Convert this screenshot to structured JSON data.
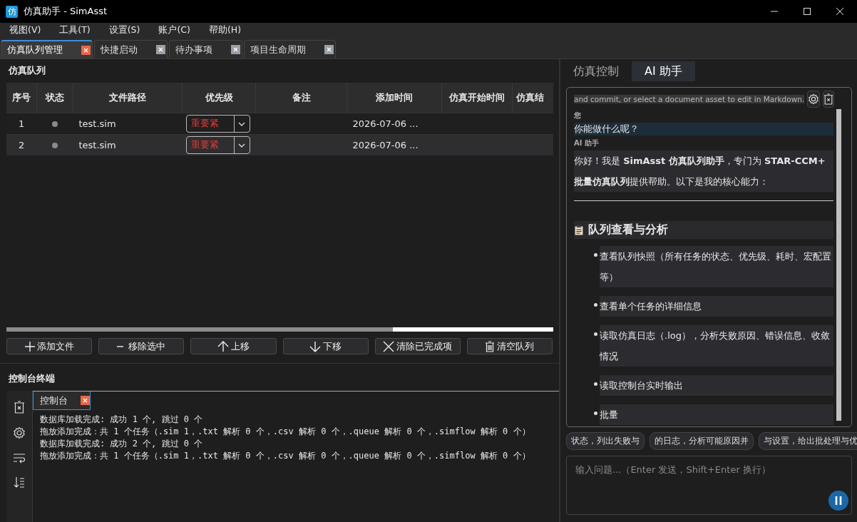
{
  "window": {
    "title": "仿真助手 - SimAsst",
    "app_icon_text": "仿"
  },
  "menu": [
    "视图(V)",
    "工具(T)",
    "设置(S)",
    "账户(C)",
    "帮助(H)"
  ],
  "tabs": [
    {
      "label": "仿真队列管理",
      "selected": true
    },
    {
      "label": "快捷启动",
      "selected": false
    },
    {
      "label": "待办事项",
      "selected": false
    },
    {
      "label": "项目生命周期",
      "selected": false
    }
  ],
  "queue": {
    "title": "仿真队列",
    "columns": [
      "序号",
      "状态",
      "文件路径",
      "优先级",
      "备注",
      "添加时间",
      "仿真开始时间",
      "仿真结"
    ],
    "rows": [
      {
        "index": "1",
        "path": "test.sim",
        "priority": "重要紧",
        "added": "2026-07-06 ...",
        "selected": false
      },
      {
        "index": "2",
        "path": "test.sim",
        "priority": "重要紧",
        "added": "2026-07-06 ...",
        "selected": true
      }
    ],
    "buttons": [
      {
        "kind": "add",
        "label": "添加文件"
      },
      {
        "kind": "remove",
        "label": "移除选中"
      },
      {
        "kind": "up",
        "label": "上移"
      },
      {
        "kind": "down",
        "label": "下移"
      },
      {
        "kind": "clear",
        "label": "清除已完成项"
      },
      {
        "kind": "trash",
        "label": "清空队列"
      }
    ]
  },
  "console": {
    "title": "控制台终端",
    "tab": "控制台",
    "lines": [
      "数据库加载完成: 成功 1 个, 跳过 0 个",
      "拖放添加完成：共 1 个任务（.sim 1，.txt 解析 0 个，.csv 解析 0 个，.queue 解析 0 个，.simflow 解析 0 个）",
      "数据库加载完成: 成功 2 个, 跳过 0 个",
      "拖放添加完成：共 1 个任务（.sim 1，.txt 解析 0 个，.csv 解析 0 个，.queue 解析 0 个，.simflow 解析 0 个）"
    ]
  },
  "side_tabs": [
    {
      "label": "仿真控制",
      "selected": false
    },
    {
      "label": "AI 助手",
      "selected": true
    }
  ],
  "chat": {
    "top_text": "and commit, or select a document asset to edit in Markdown.",
    "user_label": "您",
    "user_message": "你能做什么呢？",
    "ai_label": "AI 助手",
    "ai_message": "你好！我是 **SimAsst 仿真队列助手**，专门为 **STAR-CCM+ 批量仿真队列**提供帮助。以下是我的核心能力：",
    "heading": "队列查看与分析",
    "bullets": [
      "查看队列快照（所有任务的状态、优先级、耗时、宏配置等）",
      "查看单个任务的详细信息",
      "读取仿真日志（.log），分析失败原因、错误信息、收敛情况",
      "读取控制台实时输出",
      "批量"
    ]
  },
  "suggestions": [
    "状态，列出失败与",
    "的日志，分析可能原因并",
    "与设置，给出批处理与优"
  ],
  "input": {
    "placeholder": "输入问题...（Enter 发送，Shift+Enter 换行）"
  }
}
